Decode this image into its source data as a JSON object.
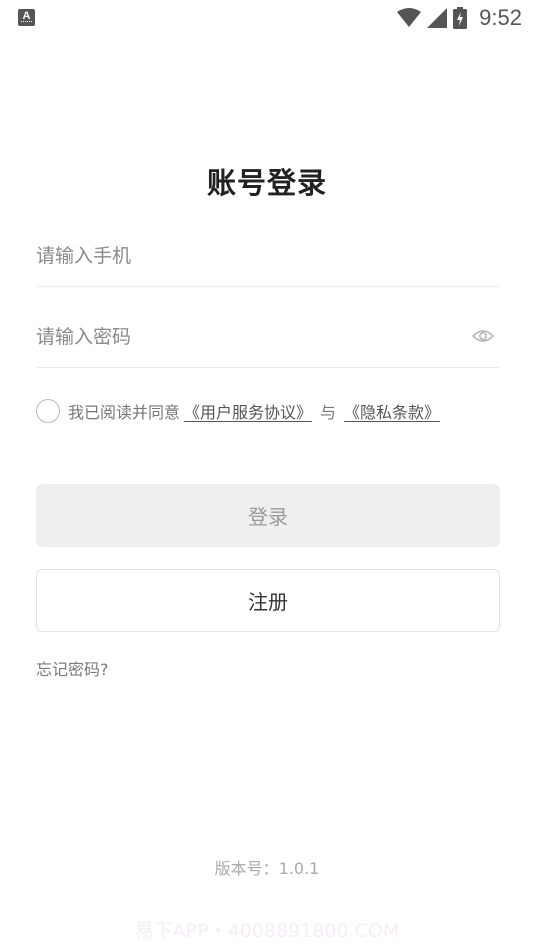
{
  "status_bar": {
    "app_badge": "A",
    "time": "9:52",
    "icons": [
      "wifi-icon",
      "cellular-signal-icon",
      "battery-charging-icon"
    ]
  },
  "page": {
    "title": "账号登录"
  },
  "form": {
    "phone_placeholder": "请输入手机",
    "phone_value": "",
    "password_placeholder": "请输入密码",
    "password_value": "",
    "password_icon": "eye-icon"
  },
  "agreement": {
    "text": "我已阅读并同意",
    "user_agreement": "《用户服务协议》",
    "and": "与",
    "privacy_policy": "《隐私条款》",
    "checked": false
  },
  "buttons": {
    "login": "登录",
    "register": "注册"
  },
  "forgot_password": "忘记密码?",
  "version": "版本号：1.0.1",
  "watermark": "易下APP・4008891800.COM",
  "colors": {
    "login_button_bg": "#efefef",
    "login_button_text": "#9a9a9a",
    "divider": "#ececec"
  }
}
